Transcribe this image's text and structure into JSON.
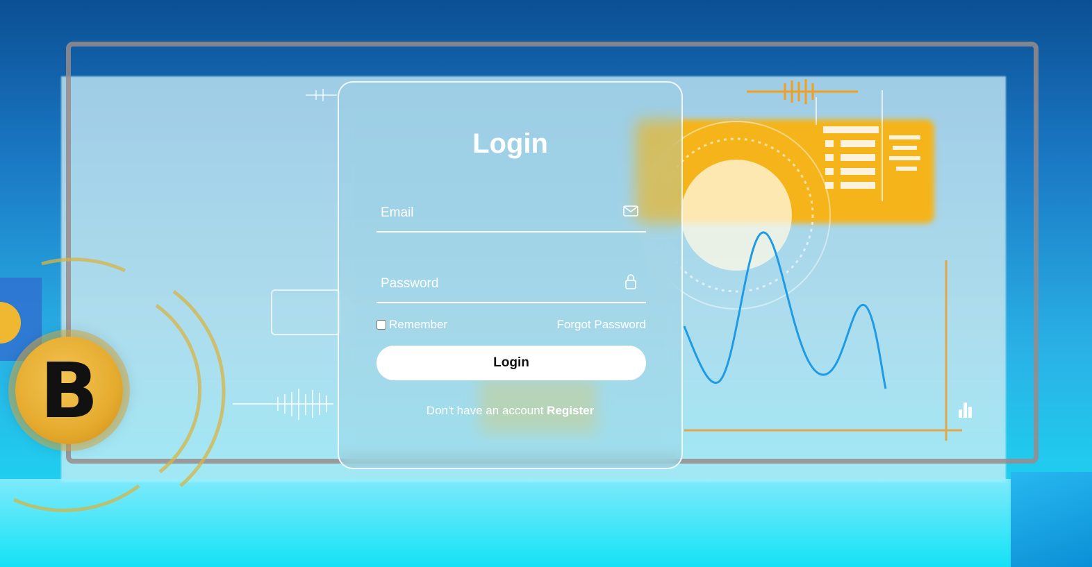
{
  "login": {
    "title": "Login",
    "email_placeholder": "Email",
    "password_placeholder": "Password",
    "remember_label": "Remember",
    "forgot_label": "Forgot Password",
    "submit_label": "Login",
    "signup_prompt": "Don't have an account",
    "register_label": "Register"
  },
  "icons": {
    "email": "envelope-icon",
    "password": "lock-icon",
    "coin": "bitcoin-icon"
  },
  "background": {
    "coin_symbol": "B"
  },
  "colors": {
    "accent_orange": "#f5b41a",
    "wave_blue": "#1e9be6",
    "background_top": "#0b4f93",
    "background_bottom": "#18e1f5"
  }
}
